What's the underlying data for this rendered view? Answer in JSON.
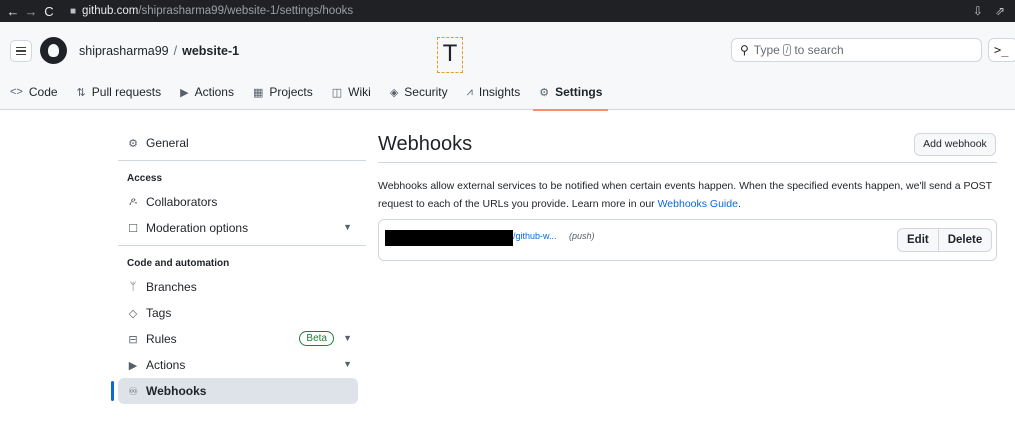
{
  "browser": {
    "url_host": "github.com",
    "url_path": "/shiprasharma99/website-1/settings/hooks"
  },
  "header": {
    "owner": "shiprasharma99",
    "separator": "/",
    "repo": "website-1",
    "cursor_glyph": "T",
    "search_prefix": "Type",
    "search_slash": "/",
    "search_suffix": "to search",
    "command_label": ">_"
  },
  "tabs": [
    {
      "label": "Code",
      "icon": "code-icon"
    },
    {
      "label": "Pull requests",
      "icon": "pull-request-icon"
    },
    {
      "label": "Actions",
      "icon": "play-icon"
    },
    {
      "label": "Projects",
      "icon": "table-icon"
    },
    {
      "label": "Wiki",
      "icon": "book-icon"
    },
    {
      "label": "Security",
      "icon": "shield-icon"
    },
    {
      "label": "Insights",
      "icon": "graph-icon"
    },
    {
      "label": "Settings",
      "icon": "gear-icon",
      "active": true
    }
  ],
  "sidebar": {
    "general": "General",
    "access_heading": "Access",
    "collaborators": "Collaborators",
    "moderation": "Moderation options",
    "automation_heading": "Code and automation",
    "branches": "Branches",
    "tags": "Tags",
    "rules": "Rules",
    "rules_badge": "Beta",
    "actions": "Actions",
    "webhooks": "Webhooks"
  },
  "main": {
    "title": "Webhooks",
    "add_button": "Add webhook",
    "description_1": "Webhooks allow external services to be notified when certain events happen. When the specified events happen, we'll send a POST request to each of the URLs you provide. Learn more in our ",
    "description_link": "Webhooks Guide",
    "description_2": ".",
    "hook": {
      "url_suffix": "/github-w...",
      "event": "(push)",
      "edit_label": "Edit",
      "delete_label": "Delete"
    }
  }
}
